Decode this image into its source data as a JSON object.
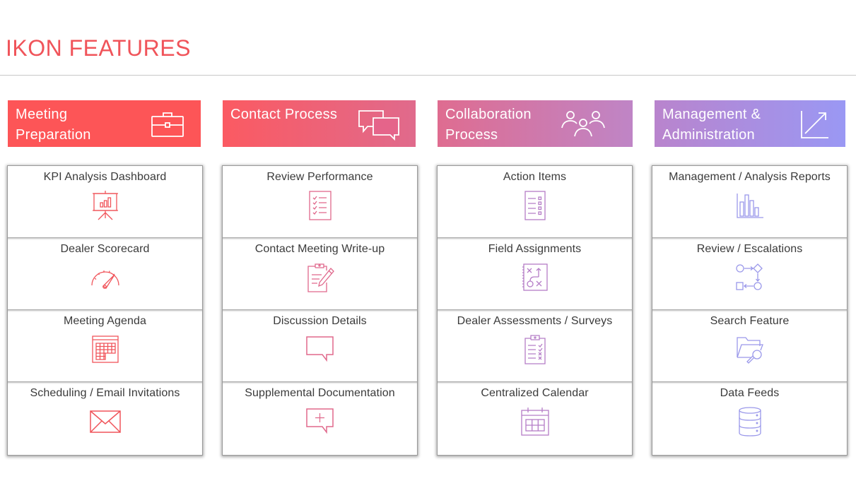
{
  "page": {
    "title": "IKON FEATURES"
  },
  "columns": [
    {
      "header": "Meeting Preparation",
      "header_icon": "briefcase-icon",
      "color": "#f0545a",
      "items": [
        {
          "label": "KPI Analysis Dashboard",
          "icon": "presentation-chart-icon"
        },
        {
          "label": "Dealer Scorecard",
          "icon": "speedometer-icon"
        },
        {
          "label": "Meeting Agenda",
          "icon": "calendar-grid-icon"
        },
        {
          "label": "Scheduling / Email Invitations",
          "icon": "envelope-icon"
        }
      ]
    },
    {
      "header": "Contact Process",
      "header_icon": "chat-bubbles-icon",
      "color": "#e0688c",
      "items": [
        {
          "label": "Review Performance",
          "icon": "checklist-icon"
        },
        {
          "label": "Contact Meeting Write-up",
          "icon": "clipboard-pencil-icon"
        },
        {
          "label": "Discussion Details",
          "icon": "speech-bubble-icon"
        },
        {
          "label": "Supplemental Documentation",
          "icon": "speech-bubble-plus-icon"
        }
      ]
    },
    {
      "header": "Collaboration Process",
      "header_icon": "group-users-icon",
      "color": "#b57dc7",
      "items": [
        {
          "label": "Action Items",
          "icon": "task-list-icon"
        },
        {
          "label": "Field Assignments",
          "icon": "playbook-icon"
        },
        {
          "label": "Dealer Assessments / Surveys",
          "icon": "clipboard-survey-icon"
        },
        {
          "label": "Centralized Calendar",
          "icon": "calendar-icon"
        }
      ]
    },
    {
      "header": "Management & Administration",
      "header_icon": "trend-arrow-icon",
      "color": "#9a98ea",
      "items": [
        {
          "label": "Management / Analysis Reports",
          "icon": "bar-chart-icon"
        },
        {
          "label": "Review / Escalations",
          "icon": "workflow-icon"
        },
        {
          "label": "Search Feature",
          "icon": "folder-search-icon"
        },
        {
          "label": "Data Feeds",
          "icon": "database-icon"
        }
      ]
    }
  ]
}
